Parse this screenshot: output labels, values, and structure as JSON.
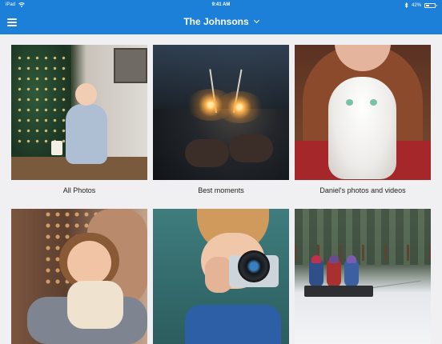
{
  "status_bar": {
    "device": "iPad",
    "time": "9:41 AM",
    "battery": "42%",
    "battery_fraction": 0.42
  },
  "nav": {
    "title": "The Johnsons",
    "menu_icon": "hamburger-menu-icon",
    "dropdown_icon": "chevron-down-icon"
  },
  "albums": [
    {
      "caption": "All Photos"
    },
    {
      "caption": "Best moments"
    },
    {
      "caption": "Daniel's photos and videos"
    },
    {
      "caption": ""
    },
    {
      "caption": ""
    },
    {
      "caption": ""
    }
  ],
  "colors": {
    "header": "#1c7fd8",
    "background": "#f0f0f2"
  }
}
